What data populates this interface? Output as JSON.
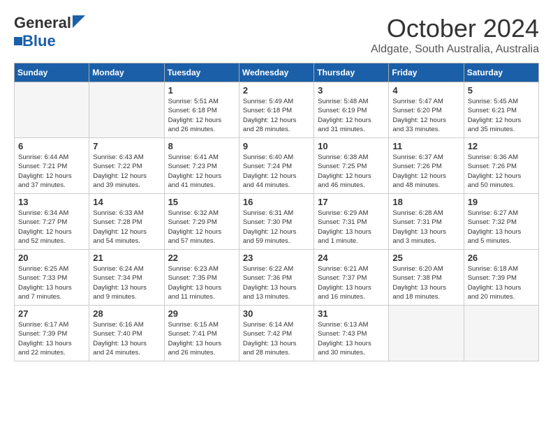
{
  "header": {
    "logo_general": "General",
    "logo_blue": "Blue",
    "month": "October 2024",
    "location": "Aldgate, South Australia, Australia"
  },
  "weekdays": [
    "Sunday",
    "Monday",
    "Tuesday",
    "Wednesday",
    "Thursday",
    "Friday",
    "Saturday"
  ],
  "weeks": [
    [
      {
        "day": "",
        "text": "",
        "empty": true
      },
      {
        "day": "",
        "text": "",
        "empty": true
      },
      {
        "day": "1",
        "text": "Sunrise: 5:51 AM\nSunset: 6:18 PM\nDaylight: 12 hours\nand 26 minutes."
      },
      {
        "day": "2",
        "text": "Sunrise: 5:49 AM\nSunset: 6:18 PM\nDaylight: 12 hours\nand 28 minutes."
      },
      {
        "day": "3",
        "text": "Sunrise: 5:48 AM\nSunset: 6:19 PM\nDaylight: 12 hours\nand 31 minutes."
      },
      {
        "day": "4",
        "text": "Sunrise: 5:47 AM\nSunset: 6:20 PM\nDaylight: 12 hours\nand 33 minutes."
      },
      {
        "day": "5",
        "text": "Sunrise: 5:45 AM\nSunset: 6:21 PM\nDaylight: 12 hours\nand 35 minutes."
      }
    ],
    [
      {
        "day": "6",
        "text": "Sunrise: 6:44 AM\nSunset: 7:21 PM\nDaylight: 12 hours\nand 37 minutes."
      },
      {
        "day": "7",
        "text": "Sunrise: 6:43 AM\nSunset: 7:22 PM\nDaylight: 12 hours\nand 39 minutes."
      },
      {
        "day": "8",
        "text": "Sunrise: 6:41 AM\nSunset: 7:23 PM\nDaylight: 12 hours\nand 41 minutes."
      },
      {
        "day": "9",
        "text": "Sunrise: 6:40 AM\nSunset: 7:24 PM\nDaylight: 12 hours\nand 44 minutes."
      },
      {
        "day": "10",
        "text": "Sunrise: 6:38 AM\nSunset: 7:25 PM\nDaylight: 12 hours\nand 46 minutes."
      },
      {
        "day": "11",
        "text": "Sunrise: 6:37 AM\nSunset: 7:26 PM\nDaylight: 12 hours\nand 48 minutes."
      },
      {
        "day": "12",
        "text": "Sunrise: 6:36 AM\nSunset: 7:26 PM\nDaylight: 12 hours\nand 50 minutes."
      }
    ],
    [
      {
        "day": "13",
        "text": "Sunrise: 6:34 AM\nSunset: 7:27 PM\nDaylight: 12 hours\nand 52 minutes."
      },
      {
        "day": "14",
        "text": "Sunrise: 6:33 AM\nSunset: 7:28 PM\nDaylight: 12 hours\nand 54 minutes."
      },
      {
        "day": "15",
        "text": "Sunrise: 6:32 AM\nSunset: 7:29 PM\nDaylight: 12 hours\nand 57 minutes."
      },
      {
        "day": "16",
        "text": "Sunrise: 6:31 AM\nSunset: 7:30 PM\nDaylight: 12 hours\nand 59 minutes."
      },
      {
        "day": "17",
        "text": "Sunrise: 6:29 AM\nSunset: 7:31 PM\nDaylight: 13 hours\nand 1 minute."
      },
      {
        "day": "18",
        "text": "Sunrise: 6:28 AM\nSunset: 7:31 PM\nDaylight: 13 hours\nand 3 minutes."
      },
      {
        "day": "19",
        "text": "Sunrise: 6:27 AM\nSunset: 7:32 PM\nDaylight: 13 hours\nand 5 minutes."
      }
    ],
    [
      {
        "day": "20",
        "text": "Sunrise: 6:25 AM\nSunset: 7:33 PM\nDaylight: 13 hours\nand 7 minutes."
      },
      {
        "day": "21",
        "text": "Sunrise: 6:24 AM\nSunset: 7:34 PM\nDaylight: 13 hours\nand 9 minutes."
      },
      {
        "day": "22",
        "text": "Sunrise: 6:23 AM\nSunset: 7:35 PM\nDaylight: 13 hours\nand 11 minutes."
      },
      {
        "day": "23",
        "text": "Sunrise: 6:22 AM\nSunset: 7:36 PM\nDaylight: 13 hours\nand 13 minutes."
      },
      {
        "day": "24",
        "text": "Sunrise: 6:21 AM\nSunset: 7:37 PM\nDaylight: 13 hours\nand 16 minutes."
      },
      {
        "day": "25",
        "text": "Sunrise: 6:20 AM\nSunset: 7:38 PM\nDaylight: 13 hours\nand 18 minutes."
      },
      {
        "day": "26",
        "text": "Sunrise: 6:18 AM\nSunset: 7:39 PM\nDaylight: 13 hours\nand 20 minutes."
      }
    ],
    [
      {
        "day": "27",
        "text": "Sunrise: 6:17 AM\nSunset: 7:39 PM\nDaylight: 13 hours\nand 22 minutes."
      },
      {
        "day": "28",
        "text": "Sunrise: 6:16 AM\nSunset: 7:40 PM\nDaylight: 13 hours\nand 24 minutes."
      },
      {
        "day": "29",
        "text": "Sunrise: 6:15 AM\nSunset: 7:41 PM\nDaylight: 13 hours\nand 26 minutes."
      },
      {
        "day": "30",
        "text": "Sunrise: 6:14 AM\nSunset: 7:42 PM\nDaylight: 13 hours\nand 28 minutes."
      },
      {
        "day": "31",
        "text": "Sunrise: 6:13 AM\nSunset: 7:43 PM\nDaylight: 13 hours\nand 30 minutes."
      },
      {
        "day": "",
        "text": "",
        "empty": true
      },
      {
        "day": "",
        "text": "",
        "empty": true
      }
    ]
  ]
}
